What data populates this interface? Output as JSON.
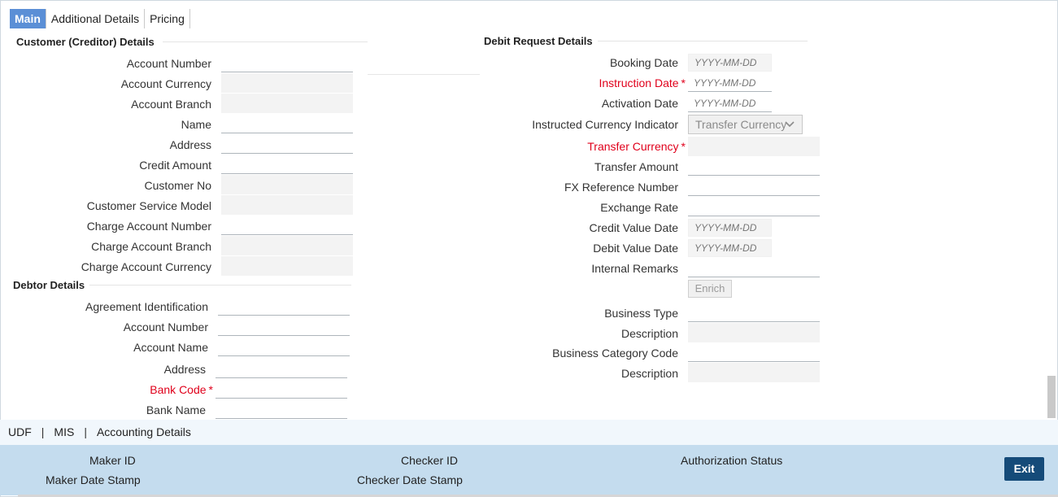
{
  "tabs": [
    "Main",
    "Additional Details",
    "Pricing"
  ],
  "customer": {
    "title": "Customer (Creditor) Details",
    "labels": [
      "Account Number",
      "Account Currency",
      "Account Branch",
      "Name",
      "Address",
      "Credit Amount",
      "Customer No",
      "Customer Service Model",
      "Charge Account Number",
      "Charge Account Branch",
      "Charge Account Currency"
    ]
  },
  "debtor": {
    "title": "Debtor Details",
    "labels": [
      "Agreement Identification",
      "Account Number",
      "Account Name",
      "Address",
      "Bank Code",
      "Bank Name"
    ]
  },
  "debit": {
    "title": "Debit Request Details",
    "booking_date": "Booking Date",
    "instruction_date": "Instruction Date",
    "activation_date": "Activation Date",
    "instructed_ccy_indicator": "Instructed Currency Indicator",
    "instructed_ccy_value": "Transfer Currency",
    "transfer_currency": "Transfer Currency",
    "transfer_amount": "Transfer Amount",
    "fx_ref": "FX Reference Number",
    "exchange_rate": "Exchange Rate",
    "credit_value_date": "Credit Value Date",
    "debit_value_date": "Debit Value Date",
    "internal_remarks": "Internal Remarks",
    "enrich": "Enrich",
    "business_type": "Business Type",
    "description": "Description",
    "business_category_code": "Business Category Code",
    "description2": "Description",
    "date_placeholder": "YYYY-MM-DD"
  },
  "required_marker": "*",
  "sub_links": [
    "UDF",
    "MIS",
    "Accounting Details"
  ],
  "sub_sep": "|",
  "footer": {
    "maker_id": "Maker ID",
    "maker_date": "Maker Date Stamp",
    "checker_id": "Checker ID",
    "checker_date": "Checker Date Stamp",
    "auth_status": "Authorization Status",
    "exit": "Exit"
  }
}
